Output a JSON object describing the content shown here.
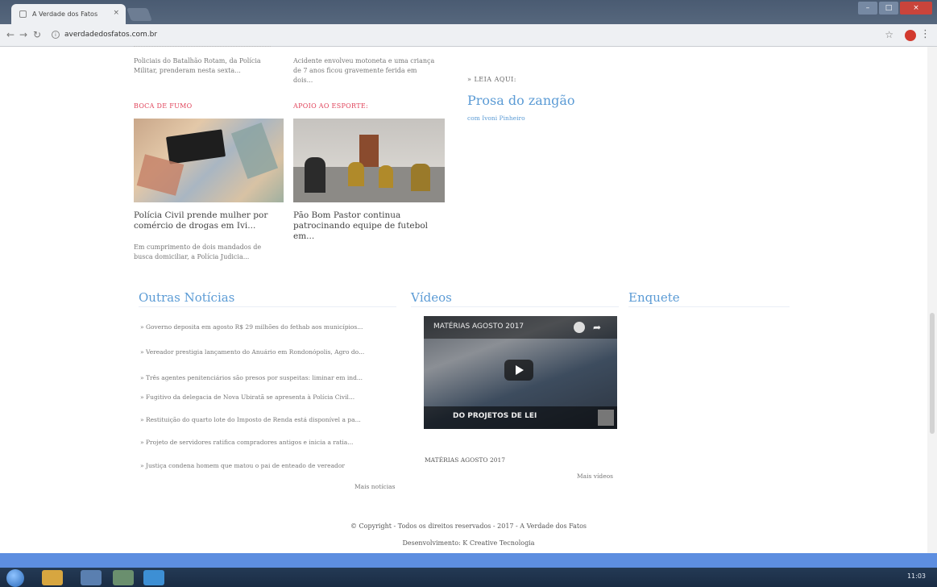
{
  "browser": {
    "tab_title": "A Verdade dos Fatos",
    "tab_close": "×",
    "url": "averdadedosfatos.com.br",
    "star_icon": "star-icon",
    "menu_icon": "⋮"
  },
  "top_snippets": {
    "left_desc": "Policiais do Batalhão Rotam, da Polícia Militar, prenderam nesta sexta...",
    "middle_desc": "Acidente envolveu motoneta e uma criança de 7 anos ficou gravemente ferida em dois..."
  },
  "leia": {
    "label": "» LEIA AQUI:",
    "title": "Prosa do zangão",
    "author": "com Ivoni Pinheiro"
  },
  "stories": [
    {
      "category": "BOCA DE FUMO",
      "headline": "Polícia Civil prende mulher por comércio de drogas em Ivi...",
      "desc": "Em cumprimento de dois mandados de busca domiciliar, a Polícia Judicia..."
    },
    {
      "category": "APOIO AO ESPORTE:",
      "headline": "Pão Bom Pastor continua patrocinando equipe de futebol em...",
      "desc": ""
    }
  ],
  "outras": {
    "title": "Outras Notícias",
    "items": [
      "» Governo deposita em agosto R$ 29 milhões do fethab aos municípios...",
      "» Vereador prestigia lançamento do Anuário em Rondonópolis, Agro do...",
      "» Três agentes penitenciários são presos por suspeitas: liminar em ind...",
      "» Fugitivo da delegacia de Nova Ubiratã se apresenta à Polícia Civil...",
      "» Restituição do quarto lote do Imposto de Renda está disponível a pa...",
      "» Projeto de servidores ratifica compradores antigos e inicia a ratia...",
      "» Justiça condena homem que matou o pai de enteado de vereador"
    ],
    "more": "Mais notícias"
  },
  "videos": {
    "title": "Vídeos",
    "caption": "MATÉRIAS AGOSTO 2017",
    "overlay_title": "MATÉRIAS AGOSTO 2017",
    "overlay_bottom": "DO PROJETOS DE LEI",
    "more": "Mais vídeos"
  },
  "enquete": {
    "title": "Enquete"
  },
  "footer": {
    "copyright": "© Copyright - Todos os direitos reservados - 2017 - A Verdade dos Fatos",
    "dev": "Desenvolvimento: K Creative Tecnologia"
  },
  "taskbar": {
    "clock": "11:03"
  }
}
